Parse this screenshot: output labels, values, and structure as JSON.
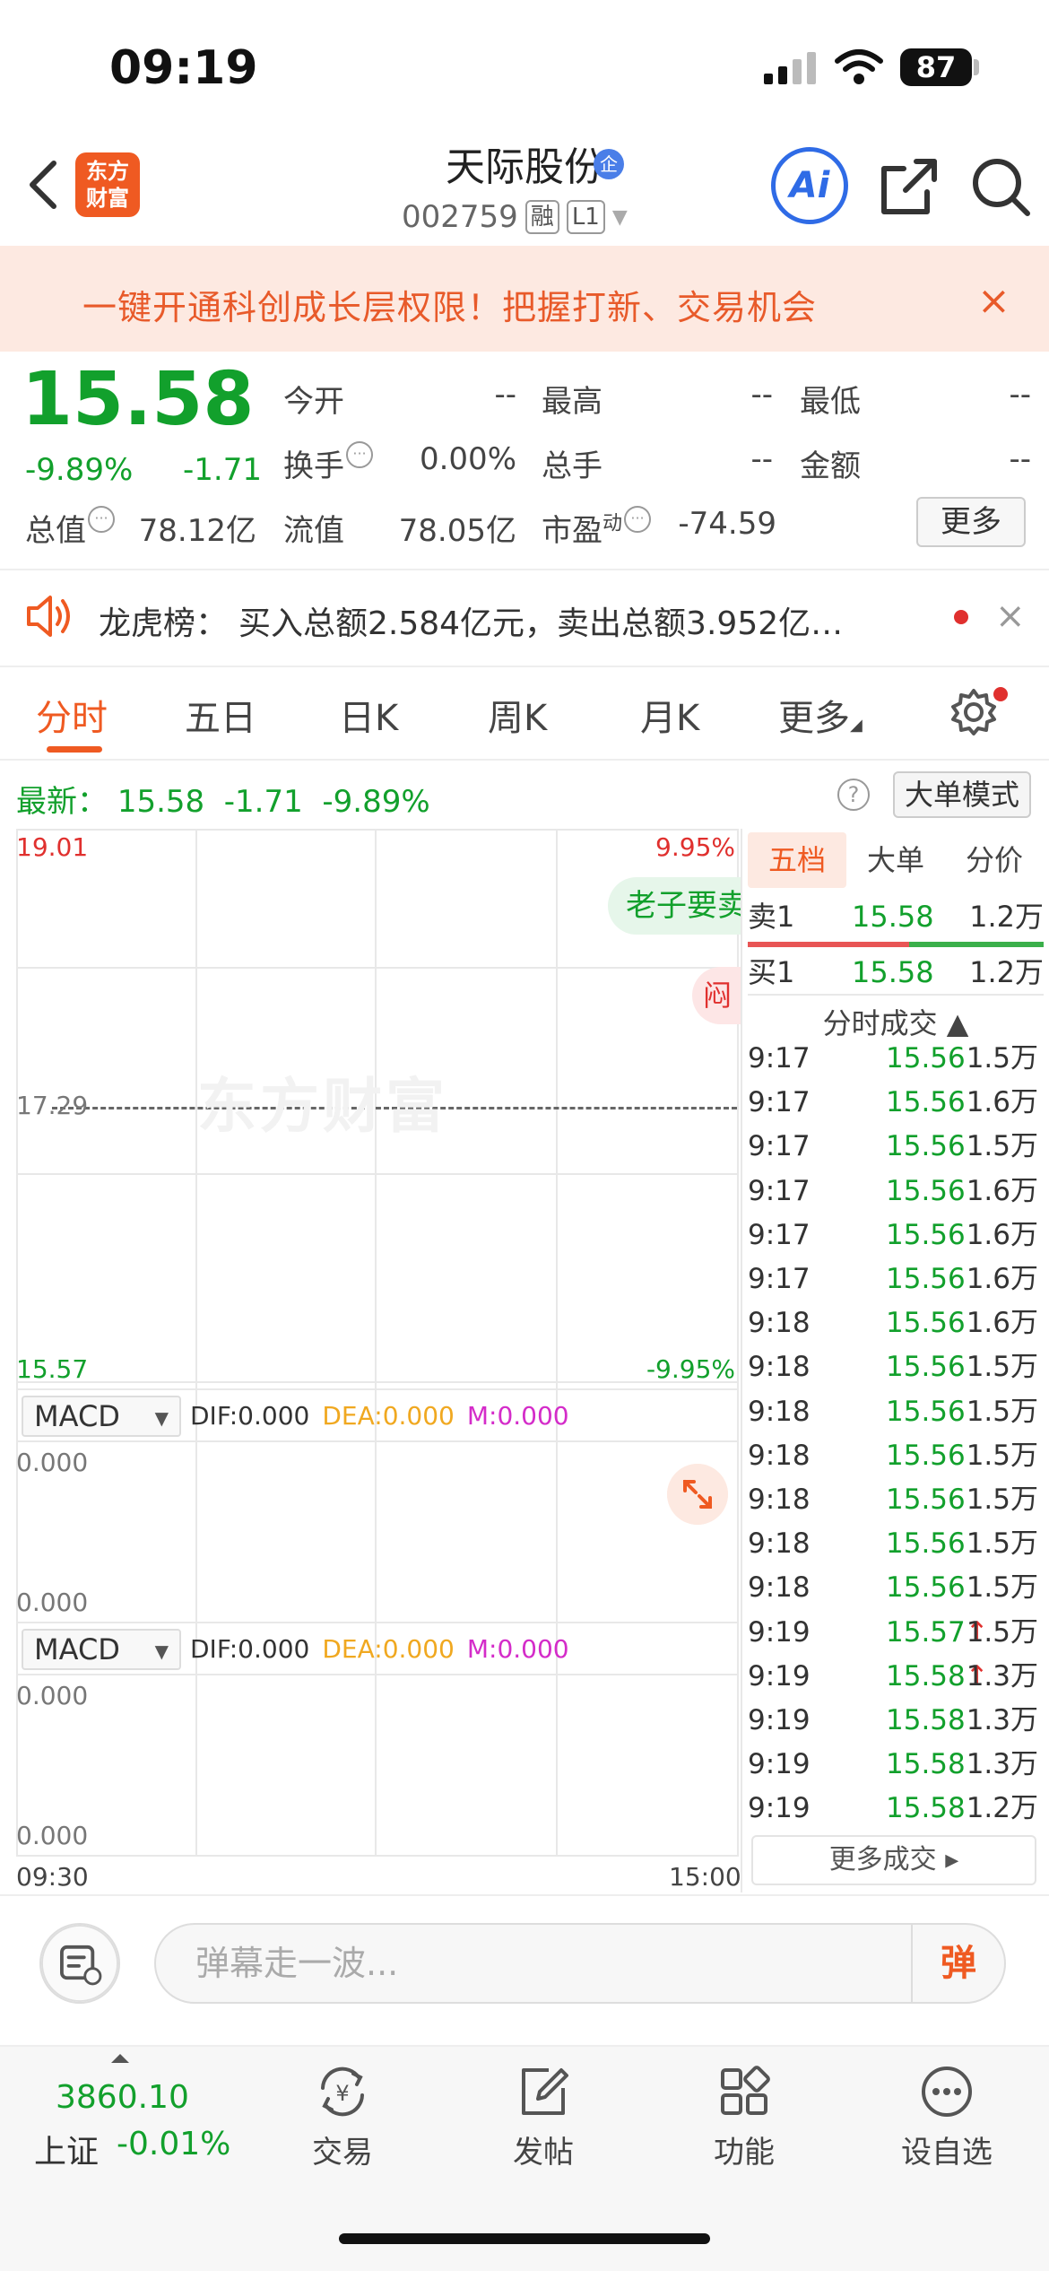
{
  "status": {
    "time": "09:19",
    "battery": "87"
  },
  "header": {
    "app_logo": "东方\n财富",
    "stock_name": "天际股份",
    "ent_badge": "企",
    "code": "002759",
    "badge_margin": "融",
    "badge_level": "L1",
    "ai_label": "Ai"
  },
  "promo": {
    "text": "一键开通科创成长层权限！把握打新、交易机会",
    "close": "×"
  },
  "quote": {
    "price": "15.58",
    "pct_change": "-9.89%",
    "abs_change": "-1.71",
    "fields": {
      "open_label": "今开",
      "open_value": "--",
      "high_label": "最高",
      "high_value": "--",
      "low_label": "最低",
      "low_value": "--",
      "turnover_label": "换手",
      "turnover_value": "0.00%",
      "volume_label": "总手",
      "volume_value": "--",
      "amount_label": "金额",
      "amount_value": "--",
      "mktcap_label": "总值",
      "mktcap_value": "78.12亿",
      "float_label": "流值",
      "float_value": "78.05亿",
      "pe_label": "市盈",
      "pe_sup": "动",
      "pe_value": "-74.59"
    },
    "more_button": "更多"
  },
  "dragon": {
    "label": "龙虎榜：",
    "text": "买入总额2.584亿元，卖出总额3.952亿…"
  },
  "tabs": [
    {
      "label": "分时"
    },
    {
      "label": "五日"
    },
    {
      "label": "日K"
    },
    {
      "label": "周K"
    },
    {
      "label": "月K"
    },
    {
      "label": "更多"
    }
  ],
  "latest": {
    "label": "最新：",
    "price": "15.58",
    "change": "-1.71",
    "pct": "-9.89%",
    "help": "?",
    "bigorder_button": "大单模式"
  },
  "chart": {
    "y_top": "19.01",
    "y_mid": "17.29",
    "y_bottom": "15.57",
    "pct_top": "9.95%",
    "pct_bottom": "-9.95%",
    "watermark": "东方财富",
    "bubble1": "老子要卖",
    "bubble2": "闷",
    "time_start": "09:30",
    "time_end": "15:00"
  },
  "macd1": {
    "name": "MACD",
    "dif": "DIF:0.000",
    "dea": "DEA:0.000",
    "m": "M:0.000",
    "y_top": "0.000",
    "y_bottom": "0.000"
  },
  "macd2": {
    "name": "MACD",
    "dif": "DIF:0.000",
    "dea": "DEA:0.000",
    "m": "M:0.000",
    "y_top": "0.000",
    "y_bottom": "0.000"
  },
  "order_panel": {
    "tabs": [
      "五档",
      "大单",
      "分价"
    ],
    "sell1": {
      "label": "卖1",
      "price": "15.58",
      "vol": "1.2万"
    },
    "buy1": {
      "label": "买1",
      "price": "15.58",
      "vol": "1.2万"
    },
    "ticks_header": "分时成交 ▲",
    "ticks": [
      {
        "time": "9:17",
        "price": "15.56",
        "arrow": "",
        "vol": "1.5万"
      },
      {
        "time": "9:17",
        "price": "15.56",
        "arrow": "",
        "vol": "1.6万"
      },
      {
        "time": "9:17",
        "price": "15.56",
        "arrow": "",
        "vol": "1.5万"
      },
      {
        "time": "9:17",
        "price": "15.56",
        "arrow": "",
        "vol": "1.6万"
      },
      {
        "time": "9:17",
        "price": "15.56",
        "arrow": "",
        "vol": "1.6万"
      },
      {
        "time": "9:17",
        "price": "15.56",
        "arrow": "",
        "vol": "1.6万"
      },
      {
        "time": "9:18",
        "price": "15.56",
        "arrow": "",
        "vol": "1.6万"
      },
      {
        "time": "9:18",
        "price": "15.56",
        "arrow": "",
        "vol": "1.5万"
      },
      {
        "time": "9:18",
        "price": "15.56",
        "arrow": "",
        "vol": "1.5万"
      },
      {
        "time": "9:18",
        "price": "15.56",
        "arrow": "",
        "vol": "1.5万"
      },
      {
        "time": "9:18",
        "price": "15.56",
        "arrow": "",
        "vol": "1.5万"
      },
      {
        "time": "9:18",
        "price": "15.56",
        "arrow": "",
        "vol": "1.5万"
      },
      {
        "time": "9:18",
        "price": "15.56",
        "arrow": "",
        "vol": "1.5万"
      },
      {
        "time": "9:19",
        "price": "15.57",
        "arrow": "↑",
        "vol": "1.5万"
      },
      {
        "time": "9:19",
        "price": "15.58",
        "arrow": "↑",
        "vol": "1.3万"
      },
      {
        "time": "9:19",
        "price": "15.58",
        "arrow": "",
        "vol": "1.3万"
      },
      {
        "time": "9:19",
        "price": "15.58",
        "arrow": "",
        "vol": "1.3万"
      },
      {
        "time": "9:19",
        "price": "15.58",
        "arrow": "",
        "vol": "1.2万"
      }
    ],
    "more_ticks": "更多成交 ▸"
  },
  "comment": {
    "placeholder": "弹幕走一波...",
    "danmu": "弹"
  },
  "bottom_nav": {
    "index_value": "3860.10",
    "index_label": "上证",
    "index_change": "-0.01%",
    "items": [
      {
        "label": "交易",
        "icon": "trade-icon"
      },
      {
        "label": "发帖",
        "icon": "post-icon"
      },
      {
        "label": "功能",
        "icon": "grid-icon"
      },
      {
        "label": "设自选",
        "icon": "more-dots-icon"
      }
    ]
  },
  "colors": {
    "accent": "#ef5a22",
    "down": "#12a02c",
    "up": "#e0302e",
    "ai_blue": "#2f6be6"
  }
}
